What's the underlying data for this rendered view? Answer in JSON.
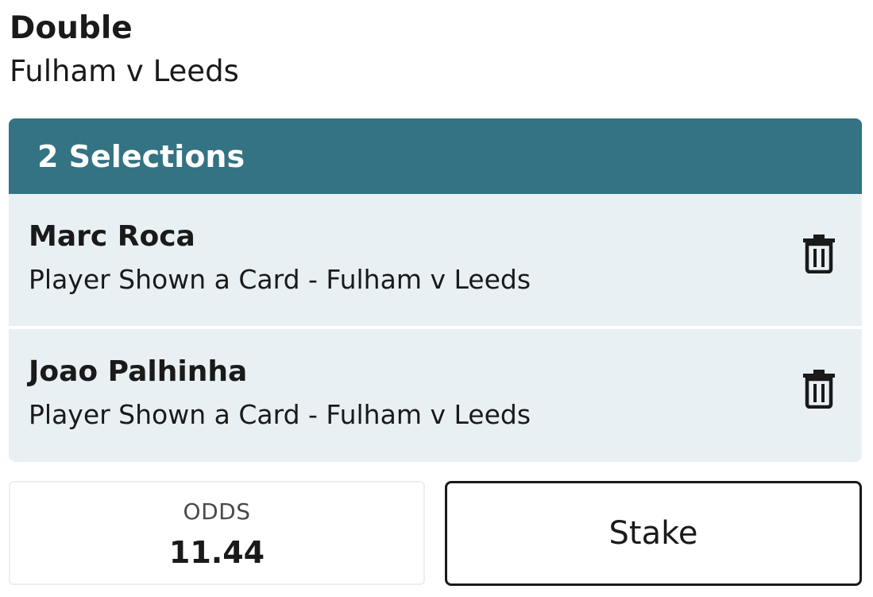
{
  "bet": {
    "type": "Double",
    "event": "Fulham v Leeds"
  },
  "selections_header": "2 Selections",
  "selections": [
    {
      "name": "Marc Roca",
      "market": "Player Shown a Card - Fulham v Leeds",
      "action_icon": "trash-icon"
    },
    {
      "name": "Joao Palhinha",
      "market": "Player Shown a Card - Fulham v Leeds",
      "action_icon": "trash-icon"
    }
  ],
  "odds": {
    "label": "ODDS",
    "value": "11.44"
  },
  "stake": {
    "placeholder": "Stake"
  },
  "colors": {
    "header_bg": "#337383",
    "row_bg": "#e8f0f4",
    "text": "#1a1a1a"
  }
}
